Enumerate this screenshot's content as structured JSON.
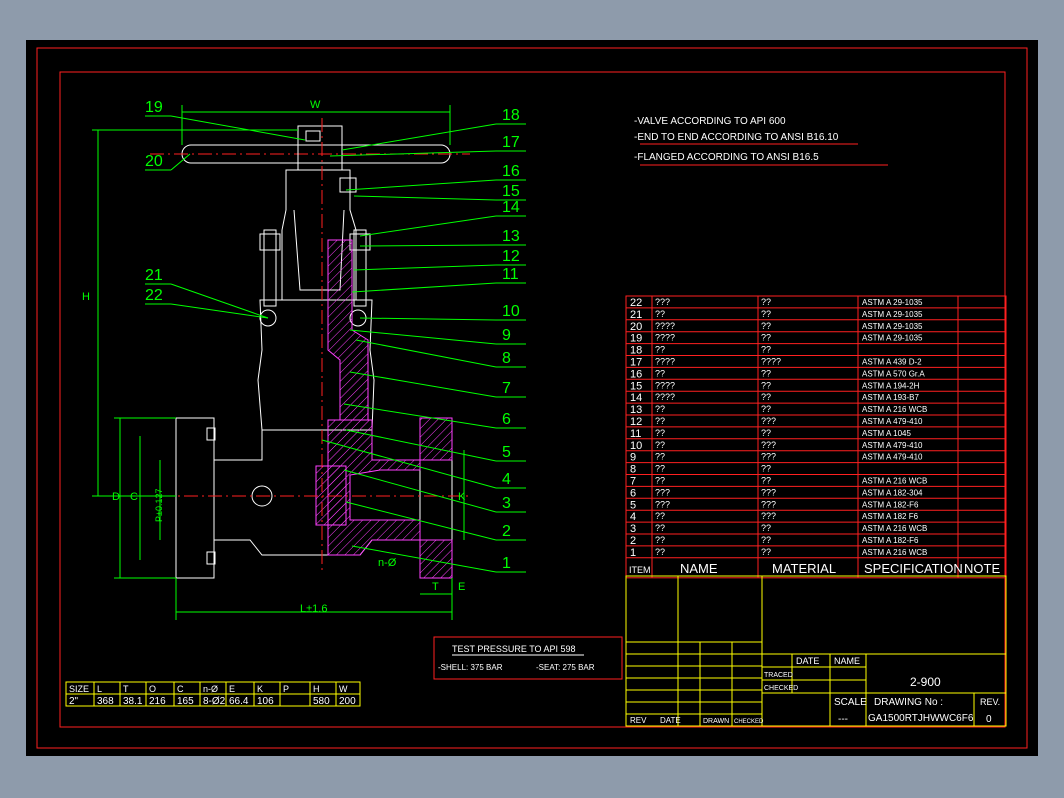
{
  "colors": {
    "background": "#8e9bab",
    "sheet": "#000000",
    "border": "#ff0000",
    "outline": "#ffffff",
    "dimension": "#00ff00",
    "hatch": "#ff00ff",
    "table_line": "#ffff00",
    "centerline": "#ff0000"
  },
  "notes": [
    "-VALVE ACCORDING TO API 600",
    "-END TO END ACCORDING TO ANSI B16.10",
    "-FLANGED ACCORDING TO ANSI B16.5"
  ],
  "test_pressure": {
    "title": "TEST PRESSURE TO API 598",
    "shell": "-SHELL: 375 BAR",
    "seat": "-SEAT: 275 BAR"
  },
  "balloons": {
    "left": [
      "19",
      "20",
      "21",
      "22"
    ],
    "right": [
      "18",
      "17",
      "16",
      "15",
      "14",
      "13",
      "12",
      "11",
      "10",
      "9",
      "8",
      "7",
      "6",
      "5",
      "4",
      "3",
      "2",
      "1"
    ]
  },
  "dimension_labels": {
    "W": "W",
    "H": "H",
    "C": "C",
    "D": "D",
    "P": "P±0.127",
    "L": "L±1.6",
    "K": "K",
    "T": "T",
    "E": "E",
    "n": "n-Ø"
  },
  "size_table": {
    "headers": [
      "SIZE",
      "L",
      "T",
      "O",
      "C",
      "n-Ø",
      "E",
      "K",
      "P",
      "H",
      "W"
    ],
    "row": [
      "2\"",
      "368",
      "38.1",
      "216",
      "165",
      "8-Ø2",
      "66.4",
      "106",
      "",
      "580",
      "200"
    ]
  },
  "parts": [
    {
      "item": "22",
      "name": "???",
      "material": "??",
      "spec": "ASTM A 29-1035"
    },
    {
      "item": "21",
      "name": "??",
      "material": "??",
      "spec": "ASTM A 29-1035"
    },
    {
      "item": "20",
      "name": "????",
      "material": "??",
      "spec": "ASTM A 29-1035"
    },
    {
      "item": "19",
      "name": "????",
      "material": "??",
      "spec": "ASTM A 29-1035"
    },
    {
      "item": "18",
      "name": "??",
      "material": "??",
      "spec": ""
    },
    {
      "item": "17",
      "name": "????",
      "material": "????",
      "spec": "ASTM A 439 D-2"
    },
    {
      "item": "16",
      "name": "??",
      "material": "??",
      "spec": "ASTM A 570 Gr.A"
    },
    {
      "item": "15",
      "name": "????",
      "material": "??",
      "spec": "ASTM A 194-2H"
    },
    {
      "item": "14",
      "name": "????",
      "material": "??",
      "spec": "ASTM A 193-B7"
    },
    {
      "item": "13",
      "name": "??",
      "material": "??",
      "spec": "ASTM A 216 WCB"
    },
    {
      "item": "12",
      "name": "??",
      "material": "???",
      "spec": "ASTM A 479-410"
    },
    {
      "item": "11",
      "name": "??",
      "material": "??",
      "spec": "ASTM A 1045"
    },
    {
      "item": "10",
      "name": "??",
      "material": "???",
      "spec": "ASTM A 479-410"
    },
    {
      "item": "9",
      "name": "??",
      "material": "???",
      "spec": "ASTM A 479-410"
    },
    {
      "item": "8",
      "name": "??",
      "material": "??",
      "spec": ""
    },
    {
      "item": "7",
      "name": "??",
      "material": "??",
      "spec": "ASTM A 216 WCB"
    },
    {
      "item": "6",
      "name": "???",
      "material": "???",
      "spec": "ASTM A 182-304"
    },
    {
      "item": "5",
      "name": "???",
      "material": "???",
      "spec": "ASTM A 182-F6"
    },
    {
      "item": "4",
      "name": "??",
      "material": "???",
      "spec": "ASTM A 182 F6"
    },
    {
      "item": "3",
      "name": "??",
      "material": "??",
      "spec": "ASTM A 216 WCB"
    },
    {
      "item": "2",
      "name": "??",
      "material": "??",
      "spec": "ASTM A 182-F6"
    },
    {
      "item": "1",
      "name": "??",
      "material": "??",
      "spec": "ASTM A 216 WCB"
    }
  ],
  "parts_header": {
    "item": "ITEM",
    "name": "NAME",
    "material": "MATERIAL",
    "spec": "SPECIFICATION",
    "note": "NOTE"
  },
  "title_block": {
    "date": "DATE",
    "name": "NAME",
    "traced": "TRACED",
    "checked": "CHECKED",
    "model": "2-900",
    "scale_label": "SCALE",
    "scale_value": "---",
    "drawing_no_label": "DRAWING No :",
    "drawing_no": "GA1500RTJHWWC6F6",
    "rev_label": "REV.",
    "rev_value": "0",
    "rev_col": "REV",
    "date_col": "DATE",
    "drawn_col": "DRAWN",
    "checked_col": "CHECKED"
  }
}
